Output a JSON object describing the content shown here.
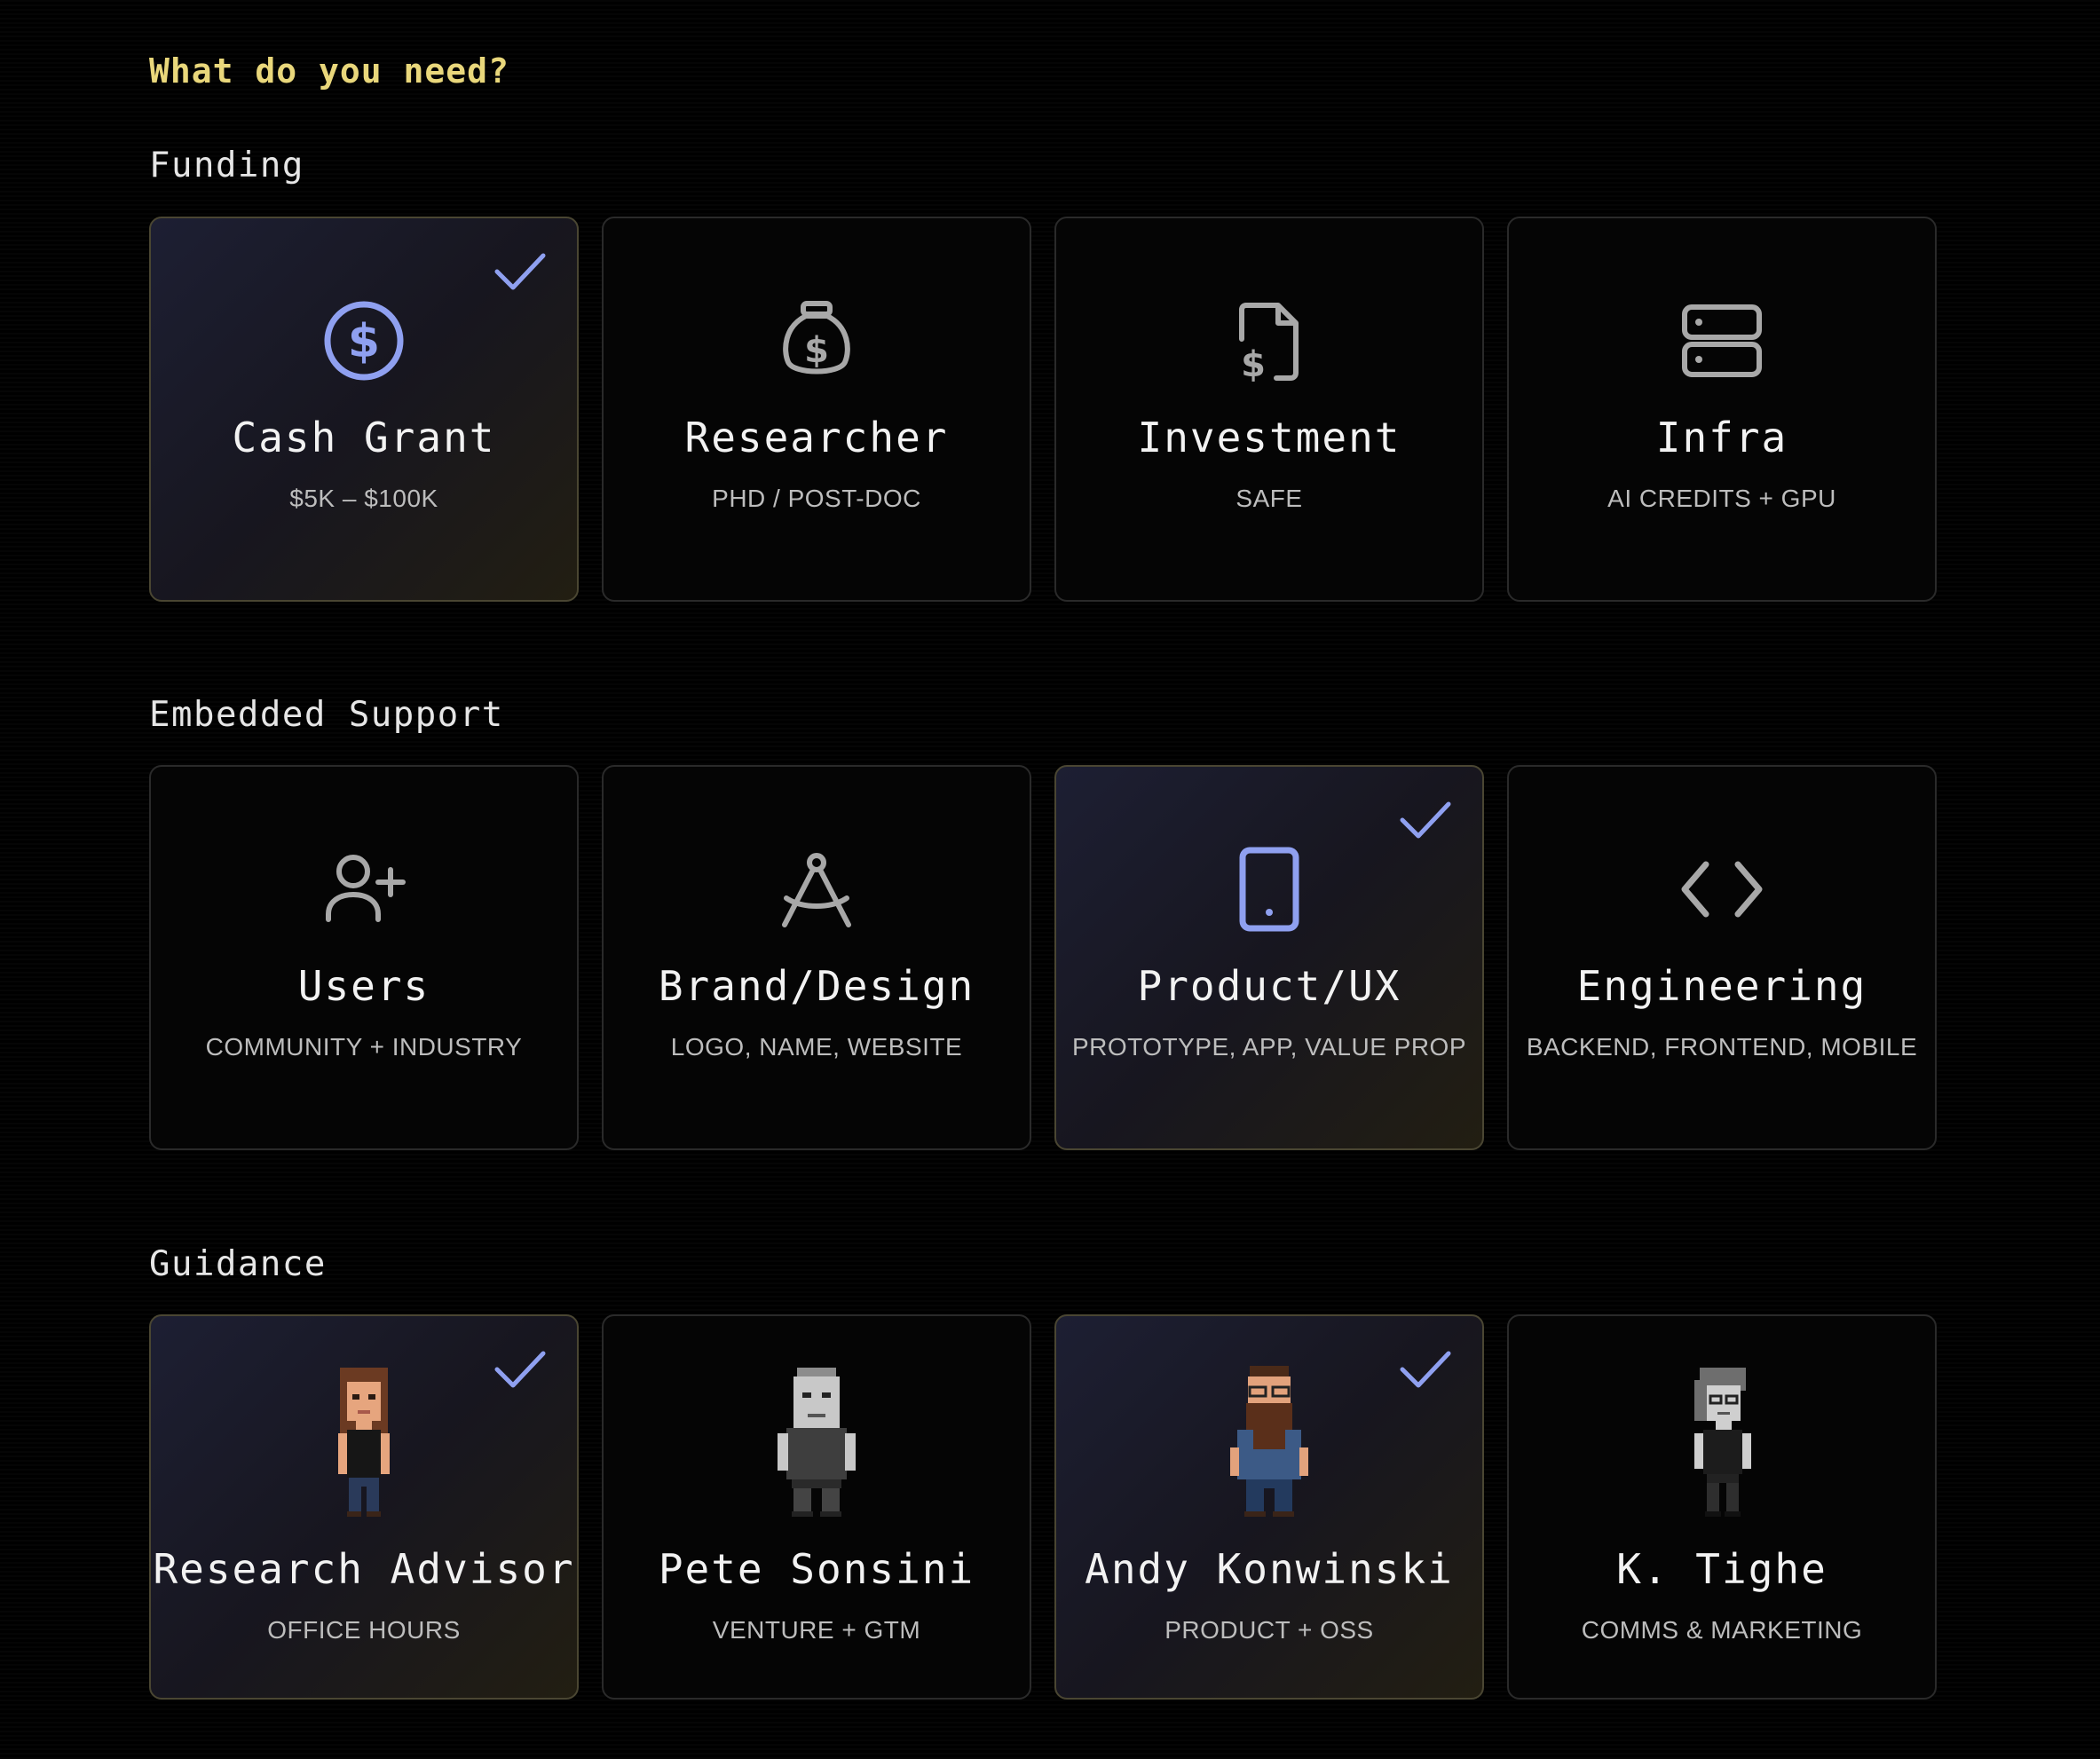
{
  "question": "What do you need?",
  "accent_color": "#8fa0f0",
  "question_color": "#e9d77b",
  "sections": [
    {
      "title": "Funding",
      "cards": [
        {
          "title": "Cash Grant",
          "sub": "$5K – $100K",
          "icon": "dollar-circle-icon",
          "selected": true
        },
        {
          "title": "Researcher",
          "sub": "PHD / POST-DOC",
          "icon": "money-bag-icon",
          "selected": false
        },
        {
          "title": "Investment",
          "sub": "SAFE",
          "icon": "file-dollar-icon",
          "selected": false
        },
        {
          "title": "Infra",
          "sub": "AI CREDITS + GPU",
          "icon": "server-icon",
          "selected": false
        }
      ]
    },
    {
      "title": "Embedded Support",
      "cards": [
        {
          "title": "Users",
          "sub": "COMMUNITY + INDUSTRY",
          "icon": "user-plus-icon",
          "selected": false
        },
        {
          "title": "Brand/Design",
          "sub": "LOGO, NAME, WEBSITE",
          "icon": "compass-drafting-icon",
          "selected": false
        },
        {
          "title": "Product/UX",
          "sub": "PROTOTYPE, APP, VALUE PROP",
          "icon": "tablet-icon",
          "selected": true
        },
        {
          "title": "Engineering",
          "sub": "BACKEND, FRONTEND, MOBILE",
          "icon": "code-icon",
          "selected": false
        }
      ]
    },
    {
      "title": "Guidance",
      "cards": [
        {
          "title": "Research Advisor",
          "sub": "OFFICE HOURS",
          "icon": "avatar-research-advisor-icon",
          "selected": true
        },
        {
          "title": "Pete Sonsini",
          "sub": "VENTURE + GTM",
          "icon": "avatar-pete-sonsini-icon",
          "selected": false
        },
        {
          "title": "Andy Konwinski",
          "sub": "PRODUCT + OSS",
          "icon": "avatar-andy-konwinski-icon",
          "selected": true
        },
        {
          "title": "K. Tighe",
          "sub": "COMMS & MARKETING",
          "icon": "avatar-k-tighe-icon",
          "selected": false
        }
      ]
    }
  ]
}
